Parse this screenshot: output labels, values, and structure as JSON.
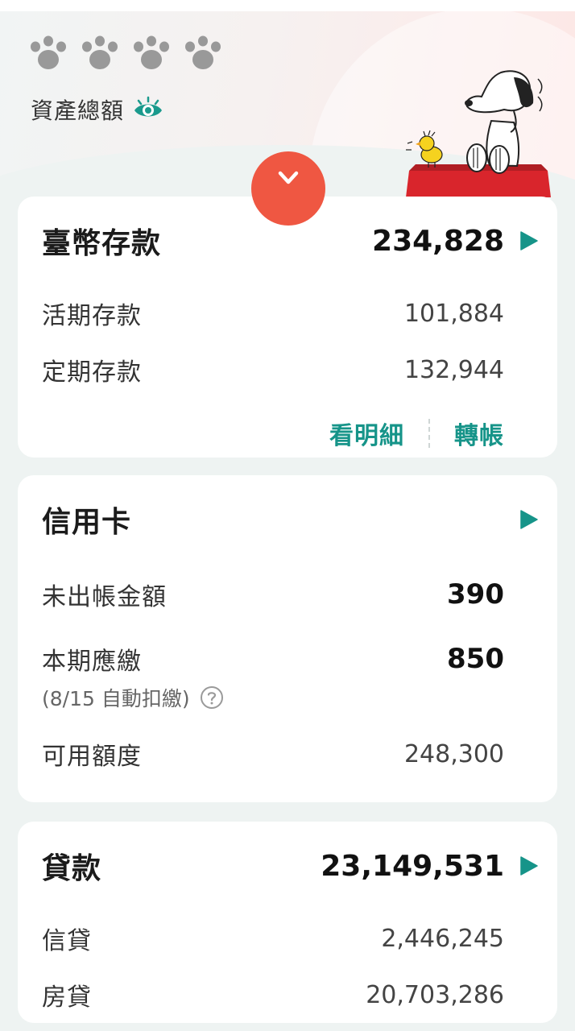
{
  "header": {
    "masked_total": "🐾🐾🐾🐾",
    "asset_label": "資產總額",
    "eye_icon": "eye-icon",
    "collapse_icon": "chevron-down-icon",
    "accent_color": "#ef5742",
    "teal_color": "#169489"
  },
  "deposits": {
    "title": "臺幣存款",
    "total": "234,828",
    "rows": [
      {
        "label": "活期存款",
        "value": "101,884"
      },
      {
        "label": "定期存款",
        "value": "132,944"
      }
    ],
    "actions": {
      "details": "看明細",
      "transfer": "轉帳"
    }
  },
  "credit_card": {
    "title": "信用卡",
    "unbilled": {
      "label": "未出帳金額",
      "value": "390"
    },
    "due": {
      "label": "本期應繳",
      "value": "850",
      "note": "(8/15 自動扣繳)"
    },
    "available": {
      "label": "可用額度",
      "value": "248,300"
    }
  },
  "loans": {
    "title": "貸款",
    "total": "23,149,531",
    "rows": [
      {
        "label": "信貸",
        "value": "2,446,245"
      },
      {
        "label": "房貸",
        "value": "20,703,286"
      }
    ]
  }
}
